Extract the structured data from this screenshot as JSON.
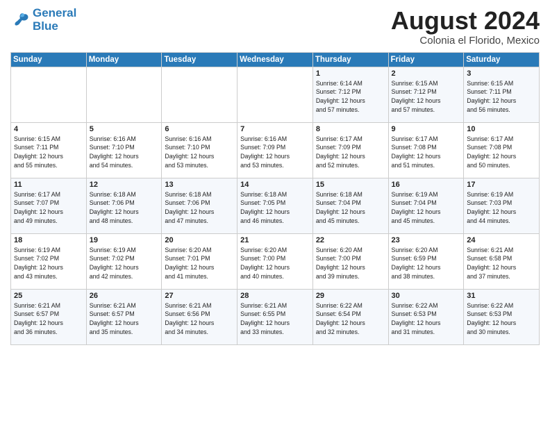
{
  "header": {
    "logo_line1": "General",
    "logo_line2": "Blue",
    "month_year": "August 2024",
    "location": "Colonia el Florido, Mexico"
  },
  "weekdays": [
    "Sunday",
    "Monday",
    "Tuesday",
    "Wednesday",
    "Thursday",
    "Friday",
    "Saturday"
  ],
  "weeks": [
    [
      {
        "day": "",
        "info": ""
      },
      {
        "day": "",
        "info": ""
      },
      {
        "day": "",
        "info": ""
      },
      {
        "day": "",
        "info": ""
      },
      {
        "day": "1",
        "info": "Sunrise: 6:14 AM\nSunset: 7:12 PM\nDaylight: 12 hours\nand 57 minutes."
      },
      {
        "day": "2",
        "info": "Sunrise: 6:15 AM\nSunset: 7:12 PM\nDaylight: 12 hours\nand 57 minutes."
      },
      {
        "day": "3",
        "info": "Sunrise: 6:15 AM\nSunset: 7:11 PM\nDaylight: 12 hours\nand 56 minutes."
      }
    ],
    [
      {
        "day": "4",
        "info": "Sunrise: 6:15 AM\nSunset: 7:11 PM\nDaylight: 12 hours\nand 55 minutes."
      },
      {
        "day": "5",
        "info": "Sunrise: 6:16 AM\nSunset: 7:10 PM\nDaylight: 12 hours\nand 54 minutes."
      },
      {
        "day": "6",
        "info": "Sunrise: 6:16 AM\nSunset: 7:10 PM\nDaylight: 12 hours\nand 53 minutes."
      },
      {
        "day": "7",
        "info": "Sunrise: 6:16 AM\nSunset: 7:09 PM\nDaylight: 12 hours\nand 53 minutes."
      },
      {
        "day": "8",
        "info": "Sunrise: 6:17 AM\nSunset: 7:09 PM\nDaylight: 12 hours\nand 52 minutes."
      },
      {
        "day": "9",
        "info": "Sunrise: 6:17 AM\nSunset: 7:08 PM\nDaylight: 12 hours\nand 51 minutes."
      },
      {
        "day": "10",
        "info": "Sunrise: 6:17 AM\nSunset: 7:08 PM\nDaylight: 12 hours\nand 50 minutes."
      }
    ],
    [
      {
        "day": "11",
        "info": "Sunrise: 6:17 AM\nSunset: 7:07 PM\nDaylight: 12 hours\nand 49 minutes."
      },
      {
        "day": "12",
        "info": "Sunrise: 6:18 AM\nSunset: 7:06 PM\nDaylight: 12 hours\nand 48 minutes."
      },
      {
        "day": "13",
        "info": "Sunrise: 6:18 AM\nSunset: 7:06 PM\nDaylight: 12 hours\nand 47 minutes."
      },
      {
        "day": "14",
        "info": "Sunrise: 6:18 AM\nSunset: 7:05 PM\nDaylight: 12 hours\nand 46 minutes."
      },
      {
        "day": "15",
        "info": "Sunrise: 6:18 AM\nSunset: 7:04 PM\nDaylight: 12 hours\nand 45 minutes."
      },
      {
        "day": "16",
        "info": "Sunrise: 6:19 AM\nSunset: 7:04 PM\nDaylight: 12 hours\nand 45 minutes."
      },
      {
        "day": "17",
        "info": "Sunrise: 6:19 AM\nSunset: 7:03 PM\nDaylight: 12 hours\nand 44 minutes."
      }
    ],
    [
      {
        "day": "18",
        "info": "Sunrise: 6:19 AM\nSunset: 7:02 PM\nDaylight: 12 hours\nand 43 minutes."
      },
      {
        "day": "19",
        "info": "Sunrise: 6:19 AM\nSunset: 7:02 PM\nDaylight: 12 hours\nand 42 minutes."
      },
      {
        "day": "20",
        "info": "Sunrise: 6:20 AM\nSunset: 7:01 PM\nDaylight: 12 hours\nand 41 minutes."
      },
      {
        "day": "21",
        "info": "Sunrise: 6:20 AM\nSunset: 7:00 PM\nDaylight: 12 hours\nand 40 minutes."
      },
      {
        "day": "22",
        "info": "Sunrise: 6:20 AM\nSunset: 7:00 PM\nDaylight: 12 hours\nand 39 minutes."
      },
      {
        "day": "23",
        "info": "Sunrise: 6:20 AM\nSunset: 6:59 PM\nDaylight: 12 hours\nand 38 minutes."
      },
      {
        "day": "24",
        "info": "Sunrise: 6:21 AM\nSunset: 6:58 PM\nDaylight: 12 hours\nand 37 minutes."
      }
    ],
    [
      {
        "day": "25",
        "info": "Sunrise: 6:21 AM\nSunset: 6:57 PM\nDaylight: 12 hours\nand 36 minutes."
      },
      {
        "day": "26",
        "info": "Sunrise: 6:21 AM\nSunset: 6:57 PM\nDaylight: 12 hours\nand 35 minutes."
      },
      {
        "day": "27",
        "info": "Sunrise: 6:21 AM\nSunset: 6:56 PM\nDaylight: 12 hours\nand 34 minutes."
      },
      {
        "day": "28",
        "info": "Sunrise: 6:21 AM\nSunset: 6:55 PM\nDaylight: 12 hours\nand 33 minutes."
      },
      {
        "day": "29",
        "info": "Sunrise: 6:22 AM\nSunset: 6:54 PM\nDaylight: 12 hours\nand 32 minutes."
      },
      {
        "day": "30",
        "info": "Sunrise: 6:22 AM\nSunset: 6:53 PM\nDaylight: 12 hours\nand 31 minutes."
      },
      {
        "day": "31",
        "info": "Sunrise: 6:22 AM\nSunset: 6:53 PM\nDaylight: 12 hours\nand 30 minutes."
      }
    ]
  ]
}
